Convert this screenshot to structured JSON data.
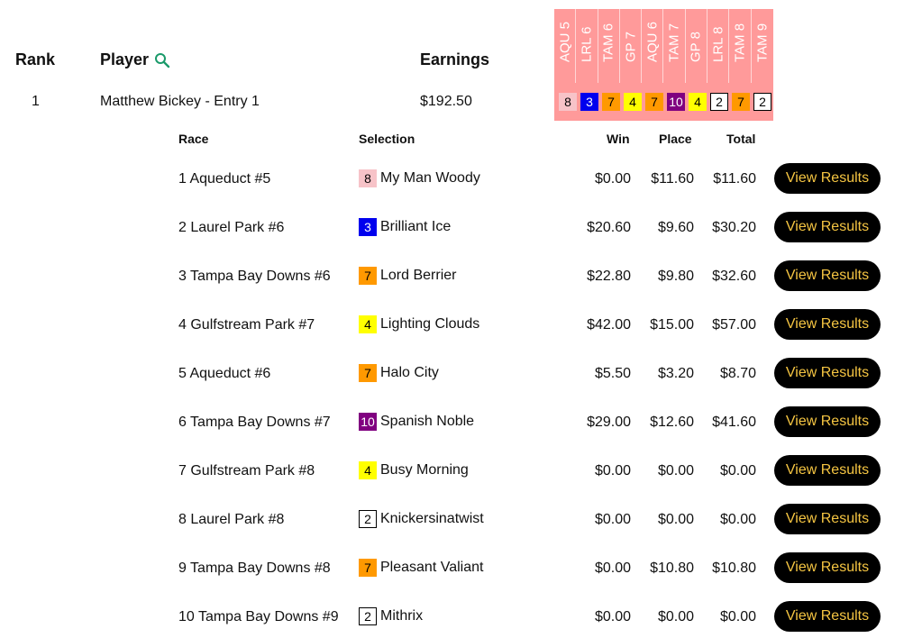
{
  "header": {
    "rank_label": "Rank",
    "player_label": "Player",
    "earnings_label": "Earnings"
  },
  "races": [
    "AQU 5",
    "LRL 6",
    "TAM 6",
    "GP 7",
    "AQU 6",
    "TAM 7",
    "GP 8",
    "LRL 8",
    "TAM 8",
    "TAM 9"
  ],
  "entry": {
    "rank": "1",
    "player": "Matthew Bickey - Entry 1",
    "earnings": "$192.50"
  },
  "picks": [
    {
      "num": "8",
      "bg": "#f7c3c8",
      "fg": "#000"
    },
    {
      "num": "3",
      "bg": "#0000ee",
      "fg": "#fff"
    },
    {
      "num": "7",
      "bg": "#ff9900",
      "fg": "#000"
    },
    {
      "num": "4",
      "bg": "#ffff00",
      "fg": "#000"
    },
    {
      "num": "7",
      "bg": "#ff9900",
      "fg": "#000"
    },
    {
      "num": "10",
      "bg": "#800080",
      "fg": "#fff"
    },
    {
      "num": "4",
      "bg": "#ffff00",
      "fg": "#000"
    },
    {
      "num": "2",
      "bg": "#ffffff",
      "fg": "#000",
      "border": "#000"
    },
    {
      "num": "7",
      "bg": "#ff9900",
      "fg": "#000"
    },
    {
      "num": "2",
      "bg": "#ffffff",
      "fg": "#000",
      "border": "#000"
    }
  ],
  "detail_headers": {
    "race": "Race",
    "selection": "Selection",
    "win": "Win",
    "place": "Place",
    "total": "Total"
  },
  "button_label": "View Results",
  "rows": [
    {
      "race": "1 Aqueduct #5",
      "num": "8",
      "horse": "My Man Woody",
      "win": "$0.00",
      "place": "$11.60",
      "total": "$11.60"
    },
    {
      "race": "2 Laurel Park #6",
      "num": "3",
      "horse": "Brilliant Ice",
      "win": "$20.60",
      "place": "$9.60",
      "total": "$30.20"
    },
    {
      "race": "3 Tampa Bay Downs #6",
      "num": "7",
      "horse": "Lord Berrier",
      "win": "$22.80",
      "place": "$9.80",
      "total": "$32.60"
    },
    {
      "race": "4 Gulfstream Park #7",
      "num": "4",
      "horse": "Lighting Clouds",
      "win": "$42.00",
      "place": "$15.00",
      "total": "$57.00"
    },
    {
      "race": "5 Aqueduct #6",
      "num": "7",
      "horse": "Halo City",
      "win": "$5.50",
      "place": "$3.20",
      "total": "$8.70"
    },
    {
      "race": "6 Tampa Bay Downs #7",
      "num": "10",
      "horse": "Spanish Noble",
      "win": "$29.00",
      "place": "$12.60",
      "total": "$41.60"
    },
    {
      "race": "7 Gulfstream Park #8",
      "num": "4",
      "horse": "Busy Morning",
      "win": "$0.00",
      "place": "$0.00",
      "total": "$0.00"
    },
    {
      "race": "8 Laurel Park #8",
      "num": "2",
      "horse": "Knickersinatwist",
      "win": "$0.00",
      "place": "$0.00",
      "total": "$0.00"
    },
    {
      "race": "9 Tampa Bay Downs #8",
      "num": "7",
      "horse": "Pleasant Valiant",
      "win": "$0.00",
      "place": "$10.80",
      "total": "$10.80"
    },
    {
      "race": "10 Tampa Bay Downs #9",
      "num": "2",
      "horse": "Mithrix",
      "win": "$0.00",
      "place": "$0.00",
      "total": "$0.00"
    }
  ]
}
